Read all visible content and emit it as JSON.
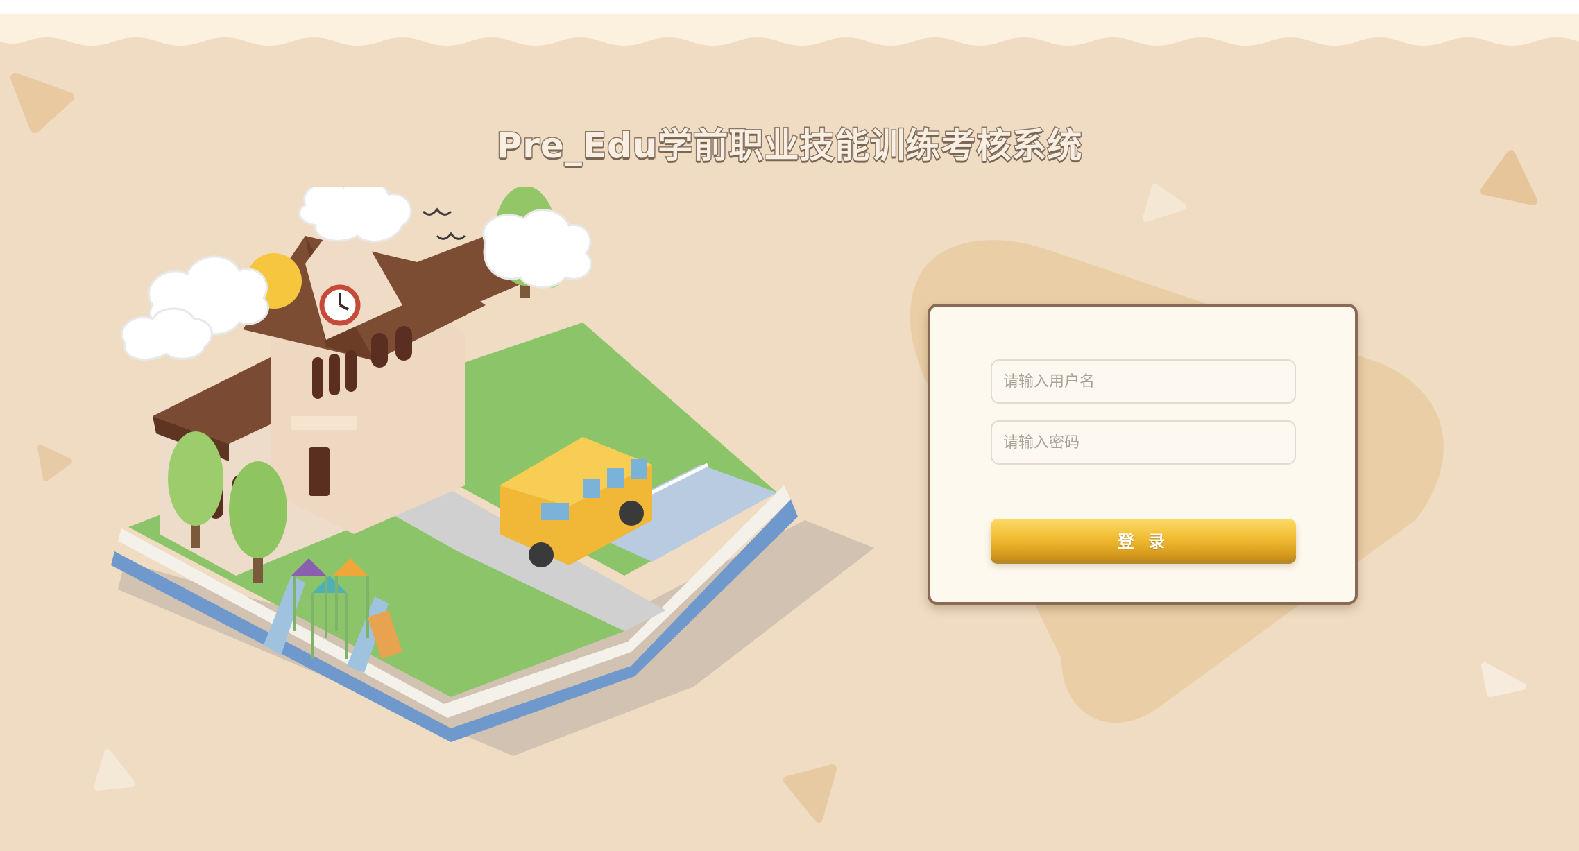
{
  "app": {
    "title": "Pre_Edu学前职业技能训练考核系统"
  },
  "login": {
    "username_placeholder": "请输入用户名",
    "password_placeholder": "请输入密码",
    "submit_label": "登 录"
  },
  "colors": {
    "background": "#efdcc3",
    "panel": "#fdf9ee",
    "panel_border": "#8a6a55",
    "button": "#f2bd34"
  }
}
